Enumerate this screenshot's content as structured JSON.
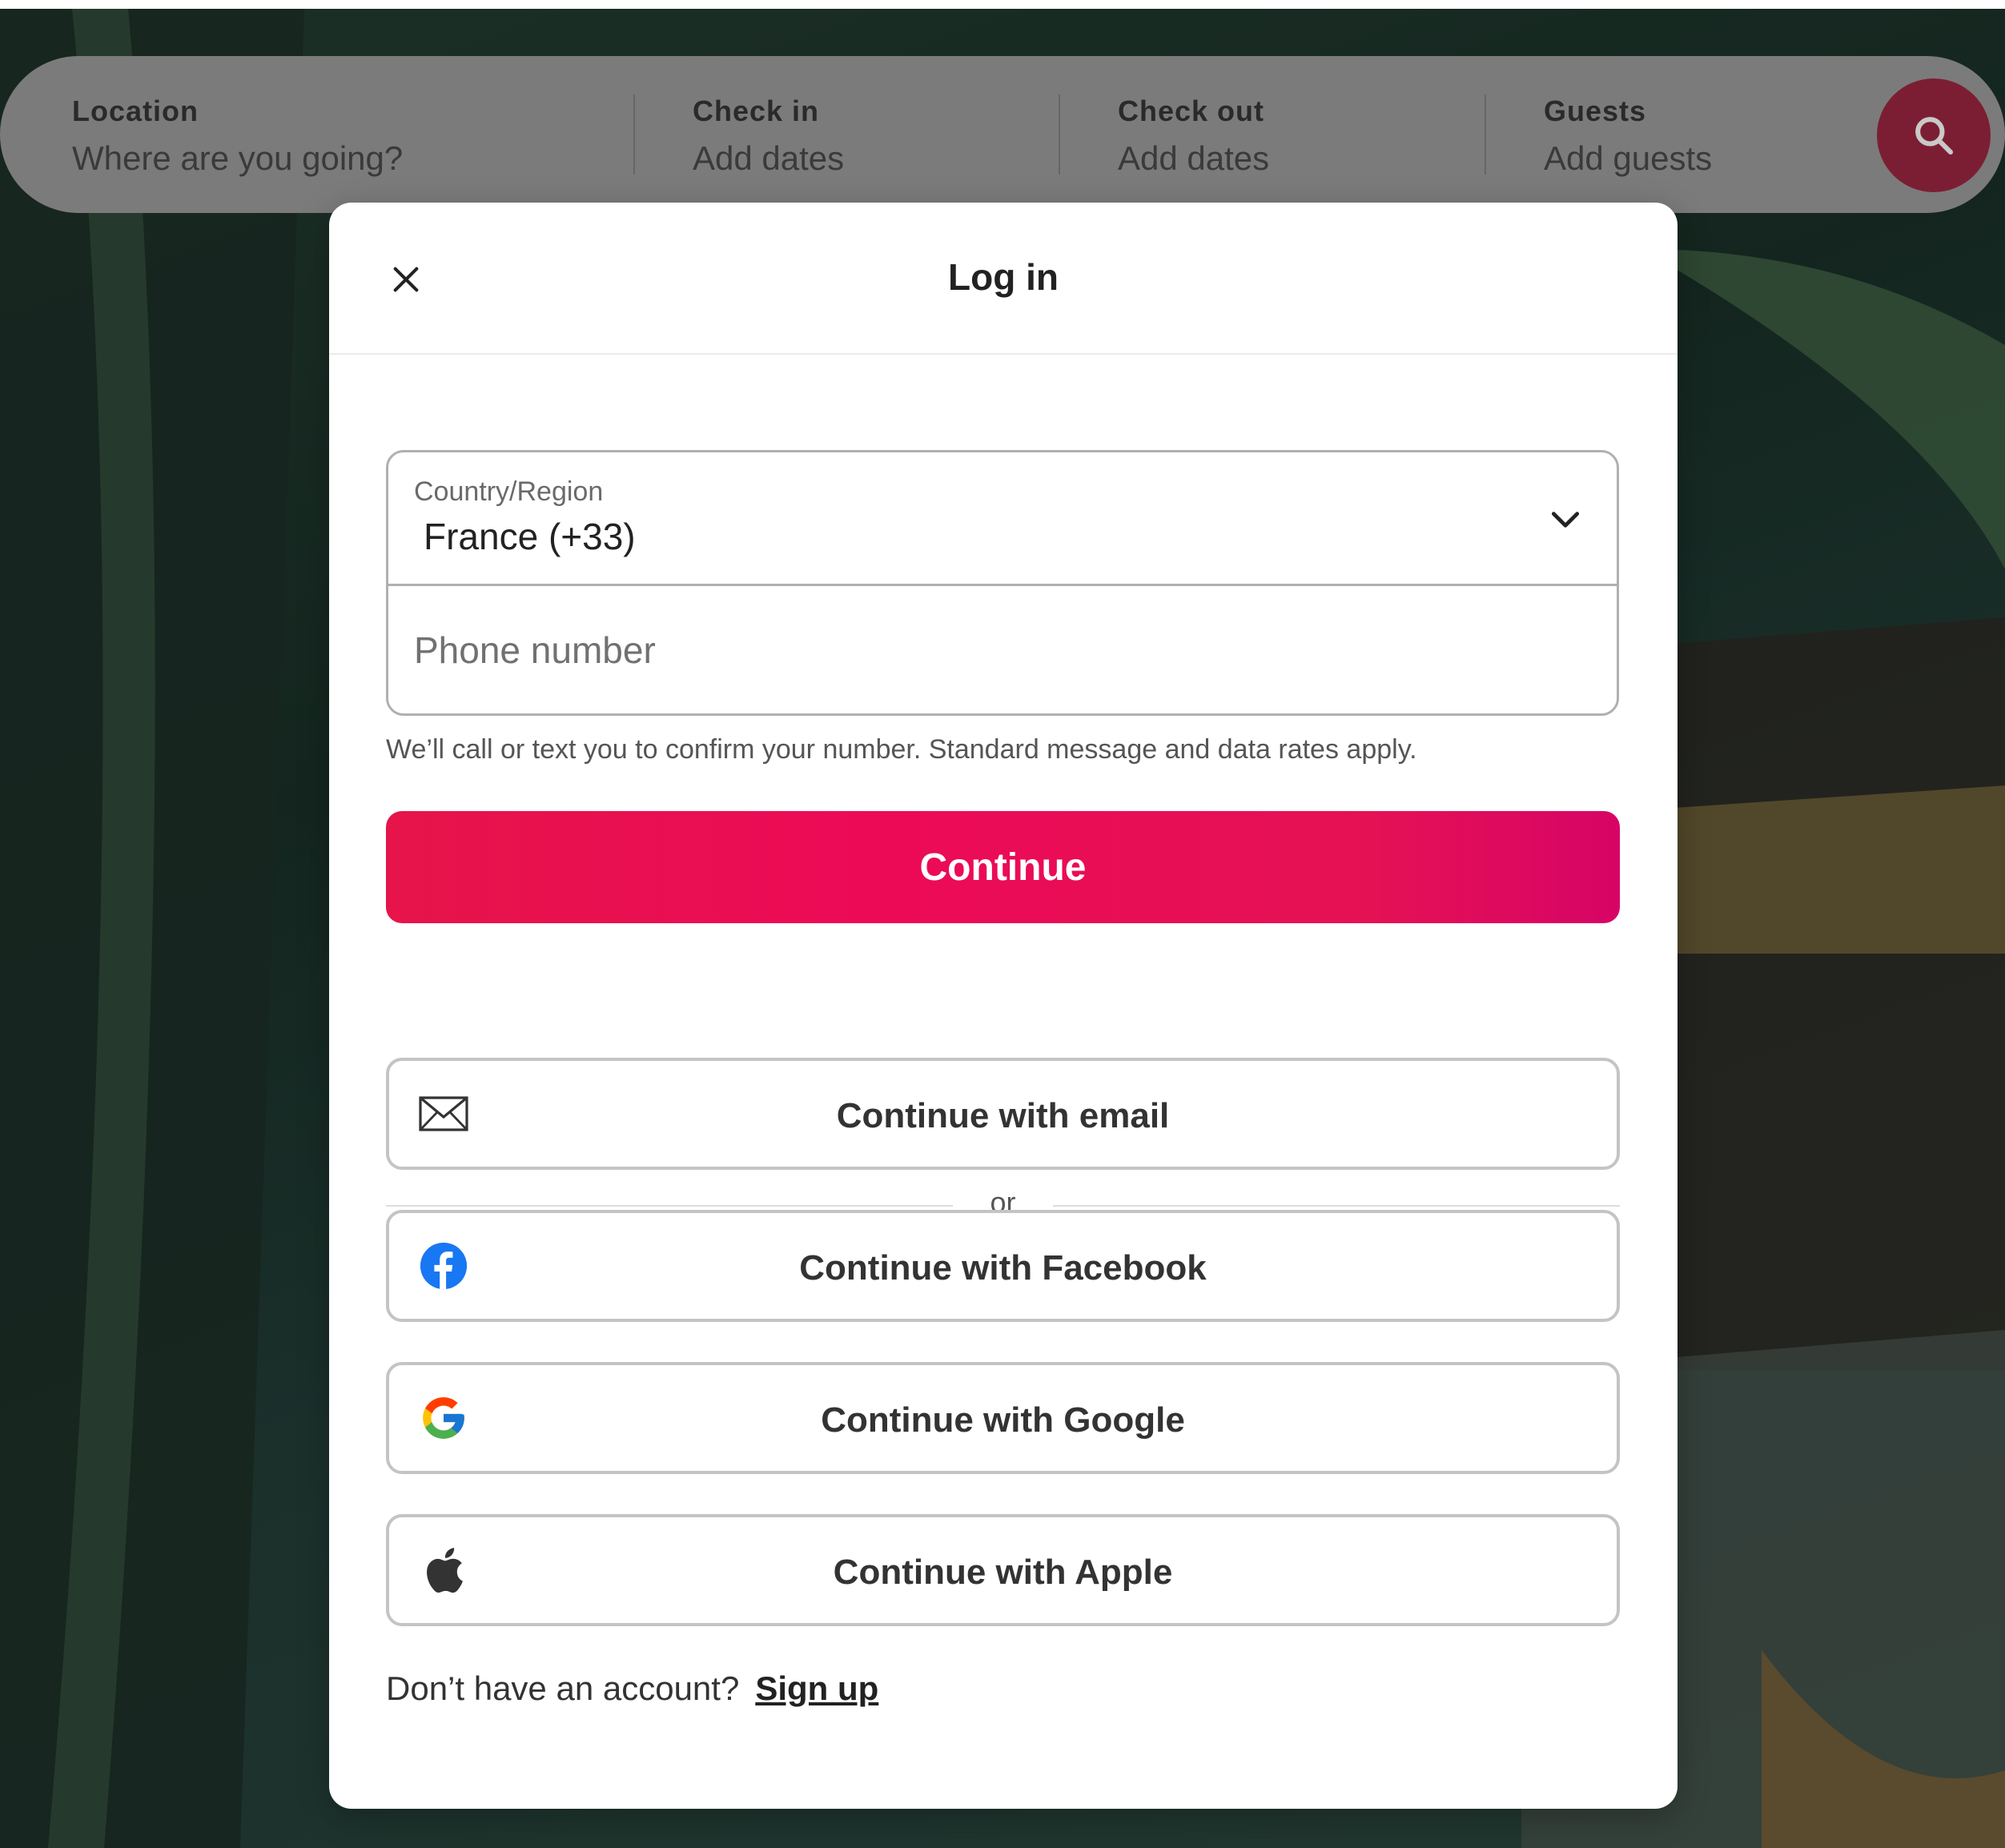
{
  "searchbar": {
    "location_label": "Location",
    "location_value": "Where are you going?",
    "checkin_label": "Check in",
    "checkin_value": "Add dates",
    "checkout_label": "Check out",
    "checkout_value": "Add dates",
    "guests_label": "Guests",
    "guests_value": "Add guests",
    "search_icon": "search-icon"
  },
  "modal": {
    "title": "Log in",
    "close_icon": "close-icon",
    "country_label": "Country/Region",
    "country_value": "France (+33)",
    "phone_placeholder": "Phone number",
    "notice": "We’ll call or text you to confirm your number. Standard message and data rates apply.",
    "continue_label": "Continue",
    "divider_text": "or",
    "alt_buttons": [
      {
        "label": "Continue with email",
        "icon": "email-icon"
      },
      {
        "label": "Continue with Facebook",
        "icon": "facebook-icon"
      },
      {
        "label": "Continue with Google",
        "icon": "google-icon"
      },
      {
        "label": "Continue with Apple",
        "icon": "apple-icon"
      }
    ],
    "signup_prompt": "Don’t have an account?",
    "signup_link": "Sign up"
  },
  "colors": {
    "brand_accent": "#e61e4d",
    "facebook_blue": "#1877f2"
  }
}
